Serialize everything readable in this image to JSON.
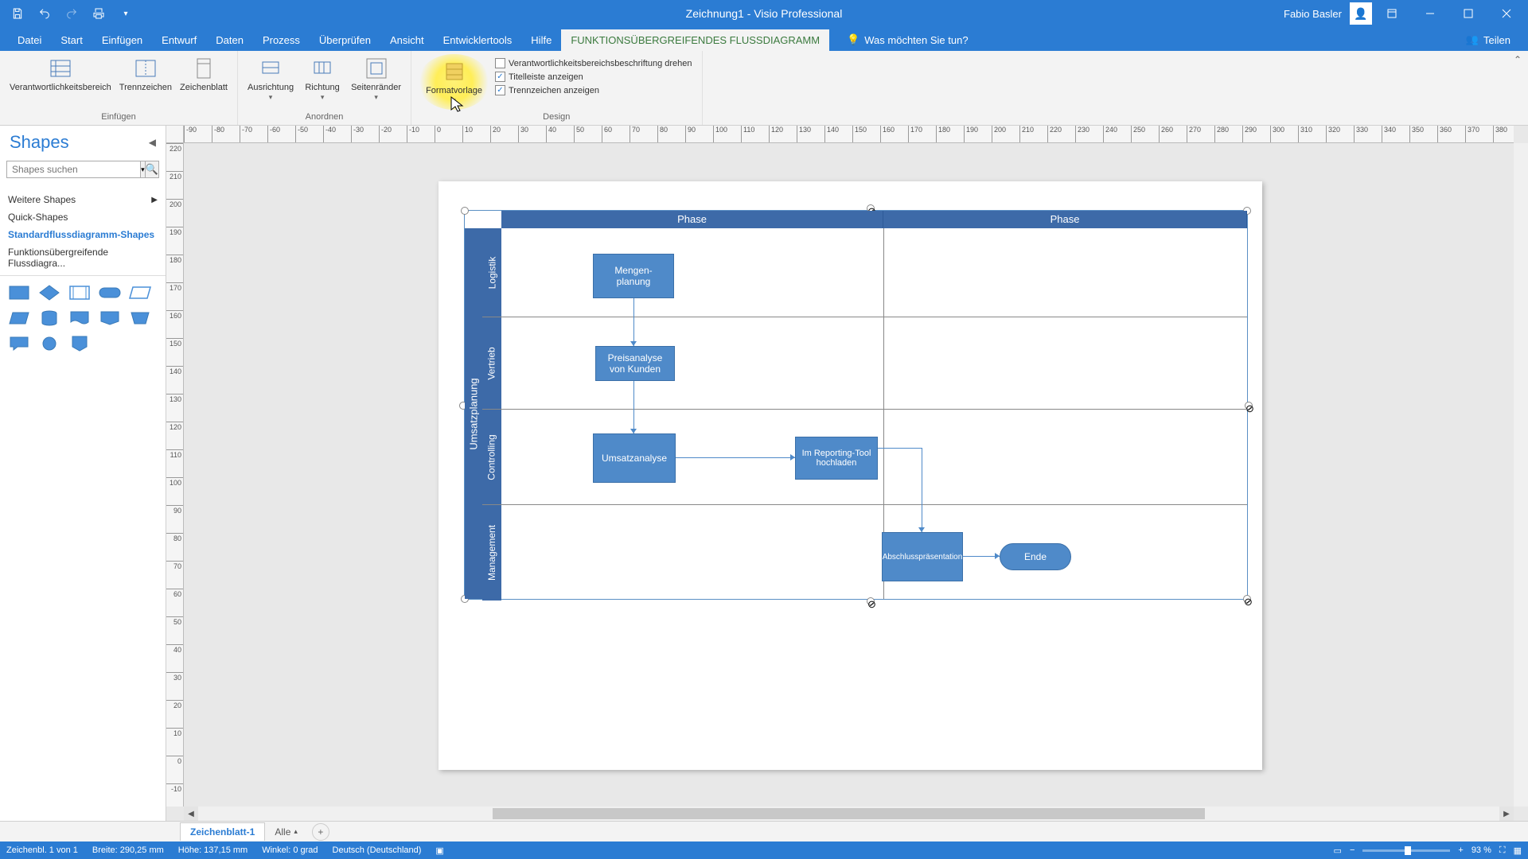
{
  "app": {
    "title": "Zeichnung1 - Visio Professional",
    "user": "Fabio Basler"
  },
  "tabs": {
    "items": [
      "Datei",
      "Start",
      "Einfügen",
      "Entwurf",
      "Daten",
      "Prozess",
      "Überprüfen",
      "Ansicht",
      "Entwicklertools",
      "Hilfe",
      "FUNKTIONSÜBERGREIFENDES FLUSSDIAGRAMM"
    ],
    "tell_me": "Was möchten Sie tun?",
    "share": "Teilen"
  },
  "ribbon": {
    "einfuegen": {
      "label": "Einfügen",
      "btn1": "Verantwortlichkeitsbereich",
      "btn2": "Trennzeichen",
      "btn3": "Zeichenblatt"
    },
    "anordnen": {
      "label": "Anordnen",
      "btn1": "Ausrichtung",
      "btn2": "Richtung",
      "btn3": "Seitenränder"
    },
    "design": {
      "label": "Design",
      "btn1": "Formatvorlage",
      "chk1": "Verantwortlichkeitsbereichsbeschriftung drehen",
      "chk2": "Titelleiste anzeigen",
      "chk3": "Trennzeichen anzeigen"
    }
  },
  "shapes": {
    "title": "Shapes",
    "search_placeholder": "Shapes suchen",
    "more": "Weitere Shapes",
    "quick": "Quick-Shapes",
    "stencil1": "Standardflussdiagramm-Shapes",
    "stencil2": "Funktionsübergreifende Flussdiagra..."
  },
  "diagram": {
    "title": "Umsatzplanung",
    "phase1": "Phase",
    "phase2": "Phase",
    "lanes": [
      "Logistik",
      "Vertrieb",
      "Controlling",
      "Management"
    ],
    "boxes": {
      "b1": "Mengen-\nplanung",
      "b2": "Preisanalyse von Kunden",
      "b3": "Umsatzanalyse",
      "b4": "Im Reporting-Tool hochladen",
      "b5": "Abschlusspräsentation",
      "b6": "Ende"
    }
  },
  "sheets": {
    "tab1": "Zeichenblatt-1",
    "all": "Alle"
  },
  "status": {
    "page": "Zeichenbl. 1 von 1",
    "width": "Breite: 290,25 mm",
    "height": "Höhe: 137,15 mm",
    "angle": "Winkel: 0 grad",
    "lang": "Deutsch (Deutschland)",
    "zoom": "93 %"
  },
  "ruler_h": [
    -90,
    -80,
    -70,
    -60,
    -50,
    -40,
    -30,
    -20,
    -10,
    0,
    10,
    20,
    30,
    40,
    50,
    60,
    70,
    80,
    90,
    100,
    110,
    120,
    130,
    140,
    150,
    160,
    170,
    180,
    190,
    200,
    210,
    220,
    230,
    240,
    250,
    260,
    270,
    280,
    290,
    300,
    310,
    320,
    330,
    340,
    350,
    360,
    370,
    380
  ],
  "ruler_v": [
    220,
    210,
    200,
    190,
    180,
    170,
    160,
    150,
    140,
    130,
    120,
    110,
    100,
    90,
    80,
    70,
    60,
    50,
    40,
    30,
    20,
    10,
    0,
    -10
  ]
}
